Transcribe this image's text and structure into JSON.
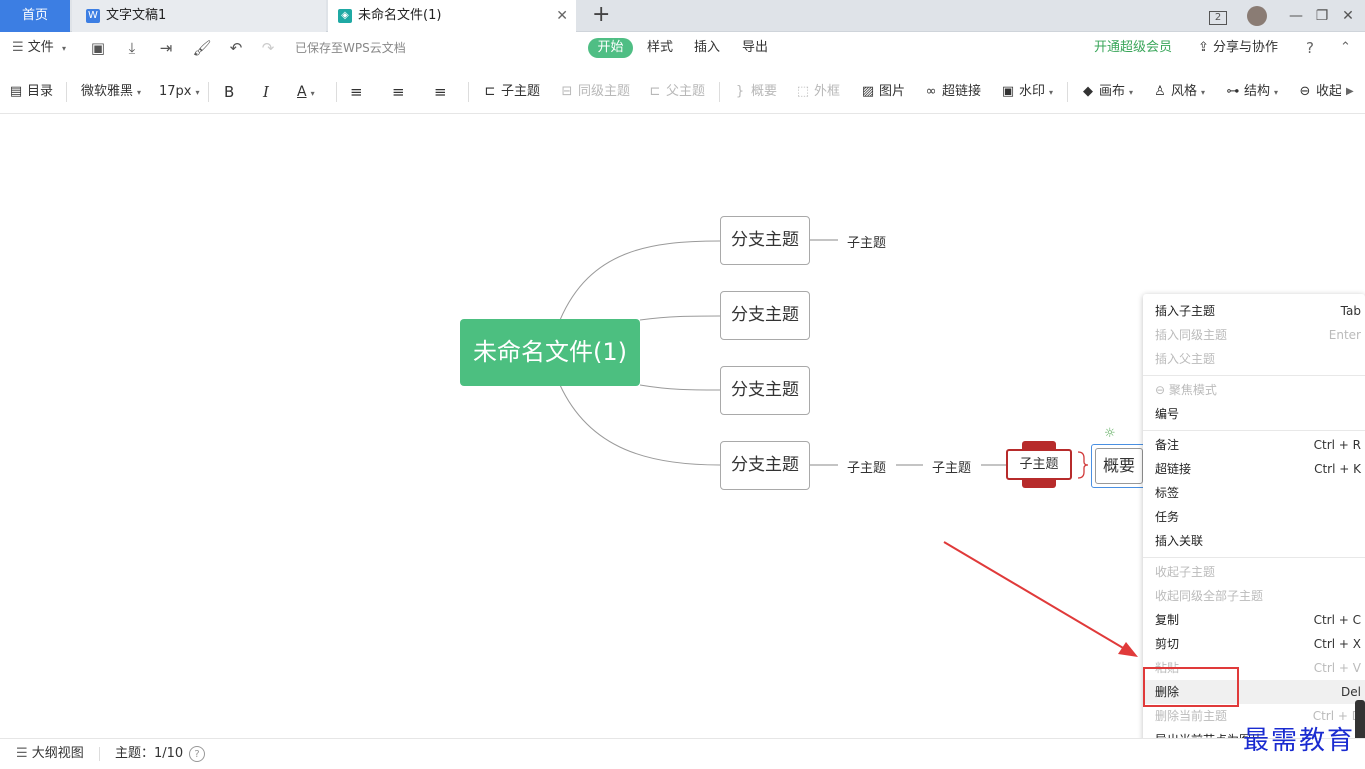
{
  "tabs": {
    "home": "首页",
    "doc": "文字文稿1",
    "active": "未命名文件(1)",
    "close": "✕",
    "new": "+"
  },
  "window": {
    "badge": "2",
    "minimize": "—",
    "restore": "❐",
    "close": "✕"
  },
  "toolbar1": {
    "file": "文件",
    "saved_status": "已保存至WPS云文档",
    "tabs": [
      "开始",
      "样式",
      "插入",
      "导出"
    ],
    "vip": "开通超级会员",
    "share": "分享与协作",
    "help": "?"
  },
  "toolbar2": {
    "outline": "目录",
    "font": "微软雅黑",
    "size": "17px",
    "bold": "B",
    "italic": "I",
    "color": "A",
    "subtopic": "子主题",
    "sibling": "同级主题",
    "parent": "父主题",
    "summary": "概要",
    "frame": "外框",
    "image": "图片",
    "link": "超链接",
    "watermark": "水印",
    "canvas": "画布",
    "style": "风格",
    "structure": "结构",
    "collapse": "收起"
  },
  "mindmap": {
    "root": "未命名文件(1)",
    "branches": [
      "分支主题",
      "分支主题",
      "分支主题",
      "分支主题"
    ],
    "child_text": "子主题",
    "summary": "概要"
  },
  "context_menu": [
    {
      "label": "插入子主题",
      "shortcut": "Tab",
      "enabled": true
    },
    {
      "label": "插入同级主题",
      "shortcut": "Enter",
      "enabled": false
    },
    {
      "label": "插入父主题",
      "shortcut": "",
      "enabled": false
    },
    {
      "label": "聚焦模式",
      "shortcut": "",
      "enabled": false
    },
    {
      "label": "编号",
      "shortcut": "",
      "enabled": true
    },
    {
      "label": "备注",
      "shortcut": "Ctrl + R",
      "enabled": true
    },
    {
      "label": "超链接",
      "shortcut": "Ctrl + K",
      "enabled": true
    },
    {
      "label": "标签",
      "shortcut": "",
      "enabled": true
    },
    {
      "label": "任务",
      "shortcut": "",
      "enabled": true
    },
    {
      "label": "插入关联",
      "shortcut": "",
      "enabled": true
    },
    {
      "label": "收起子主题",
      "shortcut": "",
      "enabled": false
    },
    {
      "label": "收起同级全部子主题",
      "shortcut": "",
      "enabled": false
    },
    {
      "label": "复制",
      "shortcut": "Ctrl + C",
      "enabled": true
    },
    {
      "label": "剪切",
      "shortcut": "Ctrl + X",
      "enabled": true
    },
    {
      "label": "粘贴",
      "shortcut": "Ctrl + V",
      "enabled": false
    },
    {
      "label": "删除",
      "shortcut": "Del",
      "enabled": true
    },
    {
      "label": "删除当前主题",
      "shortcut": "Ctrl + D",
      "enabled": false
    },
    {
      "label": "导出当前节点为图片",
      "shortcut": "",
      "enabled": true
    }
  ],
  "status": {
    "outline_view": "大纲视图",
    "topic_count": "主题：1/10",
    "help": "?"
  },
  "watermark_text": "最需教育",
  "colors": {
    "accent_green": "#4cbf80",
    "tab_blue": "#3c7ee3",
    "selected_red": "#b72b2b",
    "arrow_red": "#e03a3a"
  }
}
